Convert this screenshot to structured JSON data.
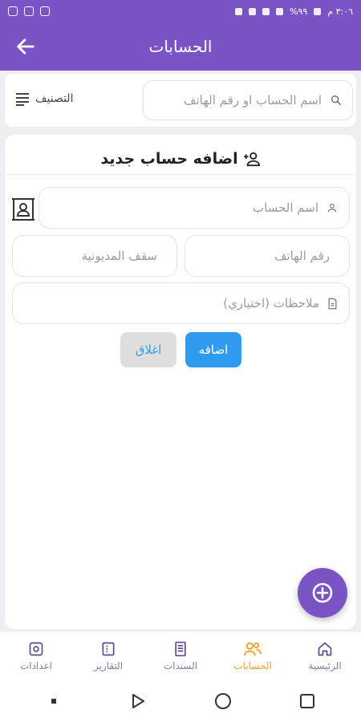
{
  "status_bar": {
    "time": "٣:٠٦ م",
    "battery": "%٩٩"
  },
  "appbar": {
    "title": "الحسابات"
  },
  "search": {
    "placeholder": "اسم الحساب او رقم الهاتف"
  },
  "sort": {
    "label": "التصنيف"
  },
  "form": {
    "title": "اضافه حساب جديد",
    "account_name_placeholder": "اسم الحساب",
    "phone_placeholder": "رقم الهاتف",
    "debt_limit_placeholder": "سقف المديونية",
    "notes_placeholder": "ملاحظات (اختياري)",
    "add_label": "اضافه",
    "close_label": "اغلاق"
  },
  "bottom_nav": {
    "items": [
      {
        "label": "اعدادات",
        "icon": "gear-icon"
      },
      {
        "label": "التقارير",
        "icon": "report-icon"
      },
      {
        "label": "السندات",
        "icon": "receipt-icon"
      },
      {
        "label": "الحسابات",
        "icon": "users-icon",
        "active": true
      },
      {
        "label": "الرئيسية",
        "icon": "home-icon"
      }
    ]
  },
  "colors": {
    "primary": "#7a54c4",
    "accent": "#f0a029",
    "button": "#2e9bf0"
  }
}
